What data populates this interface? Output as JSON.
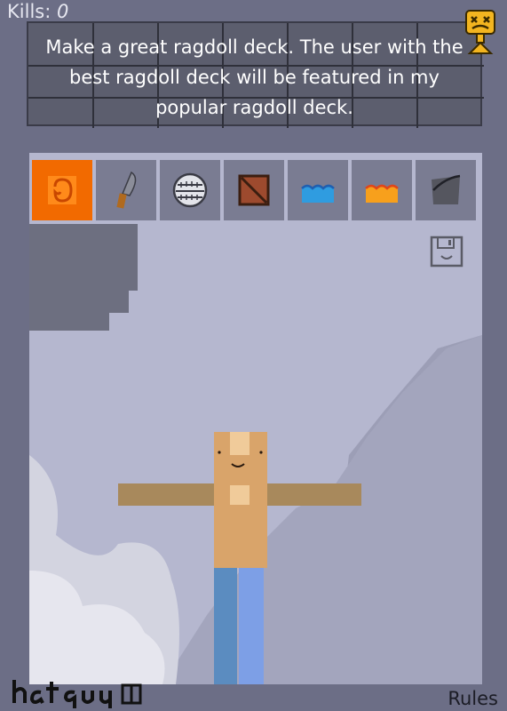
{
  "hud": {
    "kills_label": "Kills:",
    "kills_value": "0"
  },
  "prompt": {
    "text": "Make a great ragdoll deck. The user with the best ragdoll deck will be featured in my popular ragdoll deck."
  },
  "toolbar": {
    "tools": [
      {
        "name": "grab-tool-icon"
      },
      {
        "name": "knife-icon"
      },
      {
        "name": "saw-blade-icon"
      },
      {
        "name": "wooden-crate-icon"
      },
      {
        "name": "water-icon"
      },
      {
        "name": "lava-icon"
      },
      {
        "name": "metal-plate-icon"
      }
    ],
    "active_index": 0
  },
  "footer": {
    "author_signature": "hatguy",
    "rules_label": "Rules"
  },
  "colors": {
    "background": "#6c6e86",
    "scene": "#b5b7cf",
    "active_tool": "#f26a00",
    "tool": "#7a7c92",
    "skin": "#d9a46a",
    "pants": "#5b8cc0",
    "arms": "#a8895c"
  }
}
